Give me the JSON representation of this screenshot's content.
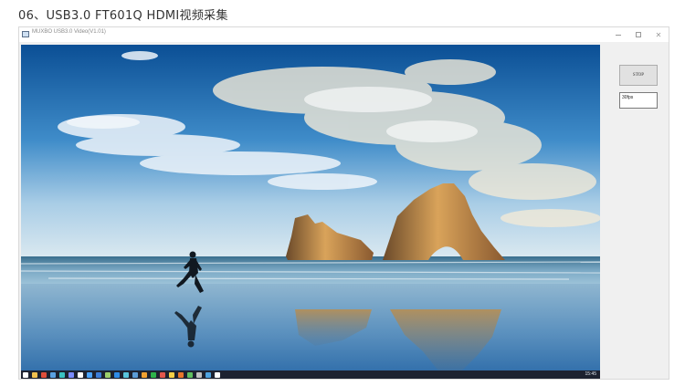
{
  "page_heading": "06、USB3.0 FT601Q HDMI视频采集",
  "window": {
    "title": "MUXBO USB3.0 Video(V1.01)",
    "controls": [
      "minimize",
      "maximize",
      "close"
    ]
  },
  "video": {
    "content": "scenic-beach-wallpaper"
  },
  "taskbar": {
    "clock": "15:45",
    "icons": [
      "windows-start-icon",
      "explorer-icon",
      "browser-icon",
      "app-icon",
      "app-icon",
      "app-icon",
      "app-icon",
      "app-icon",
      "app-icon",
      "app-icon",
      "app-icon",
      "app-icon",
      "app-icon",
      "app-icon",
      "app-icon",
      "app-icon",
      "app-icon",
      "app-icon",
      "app-icon",
      "app-icon",
      "app-icon",
      "app-icon"
    ],
    "colors": [
      "#ffffff",
      "#f2c14e",
      "#e04e39",
      "#5aa0e0",
      "#3ac2c2",
      "#7b8cff",
      "#ffffff",
      "#4aa3ff",
      "#3b7dd8",
      "#9ccf6b",
      "#2e8be6",
      "#58c4dc",
      "#5b9bd5",
      "#f0a030",
      "#2db34a",
      "#e2574c",
      "#f7d046",
      "#e8762a",
      "#5fbf5f",
      "#c0c0c0",
      "#4fa3e0",
      "#ffffff"
    ]
  },
  "controls": {
    "stop_label": "STOP",
    "fps_value": "30fps"
  }
}
